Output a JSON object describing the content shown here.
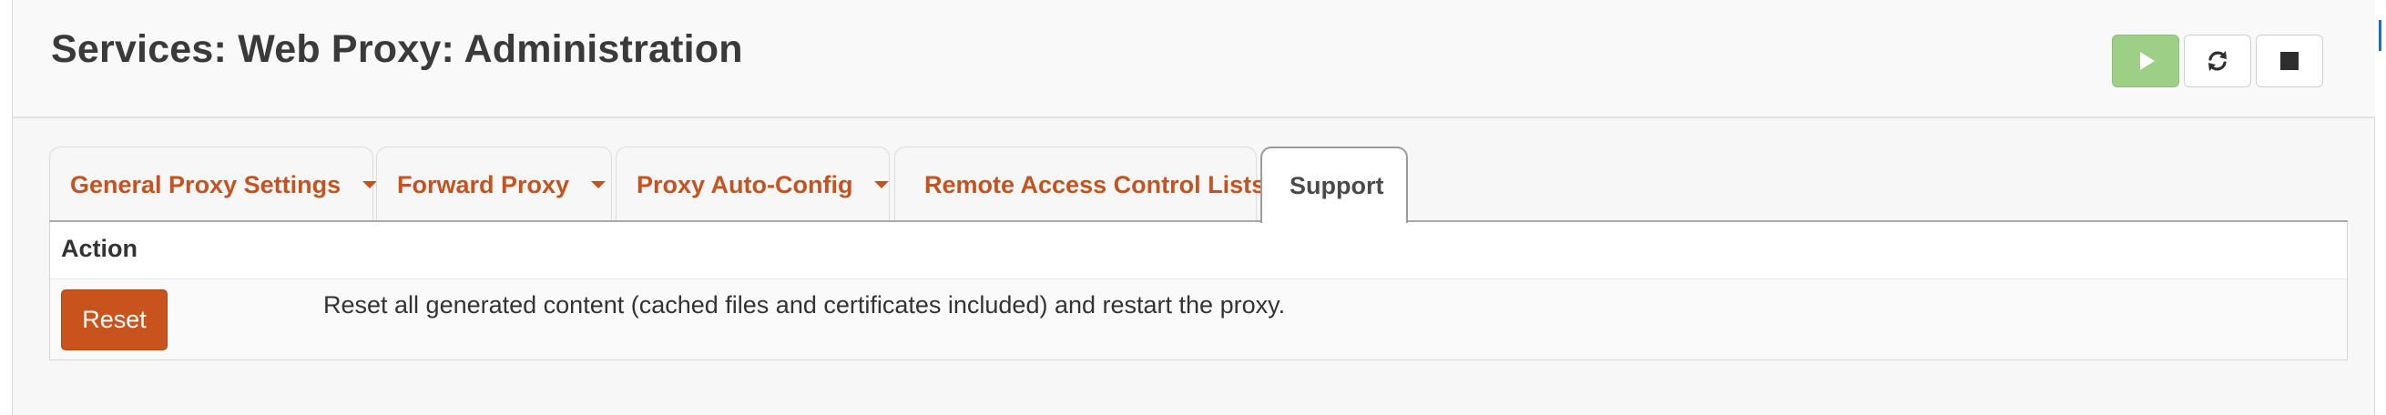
{
  "header": {
    "title": "Services: Web Proxy: Administration",
    "buttons": {
      "start_icon": "play-icon",
      "restart_icon": "refresh-icon",
      "stop_icon": "stop-icon"
    }
  },
  "tabs": [
    {
      "label": "General Proxy Settings",
      "has_dropdown": true,
      "active": false
    },
    {
      "label": "Forward Proxy",
      "has_dropdown": true,
      "active": false
    },
    {
      "label": "Proxy Auto-Config",
      "has_dropdown": true,
      "active": false
    },
    {
      "label": "Remote Access Control Lists",
      "has_dropdown": false,
      "active": false
    },
    {
      "label": "Support",
      "has_dropdown": false,
      "active": true
    }
  ],
  "panel": {
    "column_header": "Action",
    "reset_button": "Reset",
    "reset_description": "Reset all generated content (cached files and certificates included) and restart the proxy."
  },
  "colors": {
    "accent": "#c5531f",
    "start_button": "#9ecf86",
    "reset_button": "#c9531c"
  }
}
